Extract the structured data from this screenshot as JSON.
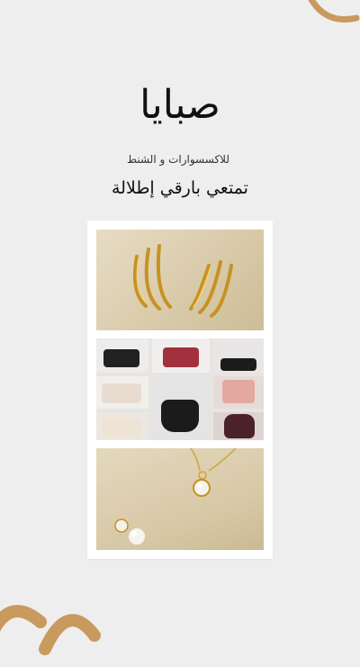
{
  "brand": {
    "title": "صبايا",
    "subtitle": "للاكسسوارات و الشنط",
    "tagline": "تمتعي بارقي إطلالة"
  },
  "gallery": [
    {
      "subject": "gold-ear-cuffs"
    },
    {
      "subject": "handbags-grid"
    },
    {
      "subject": "pearl-jewelry"
    }
  ],
  "colors": {
    "background": "#efeeee",
    "accent": "#c89a5e",
    "card": "#ffffff"
  }
}
